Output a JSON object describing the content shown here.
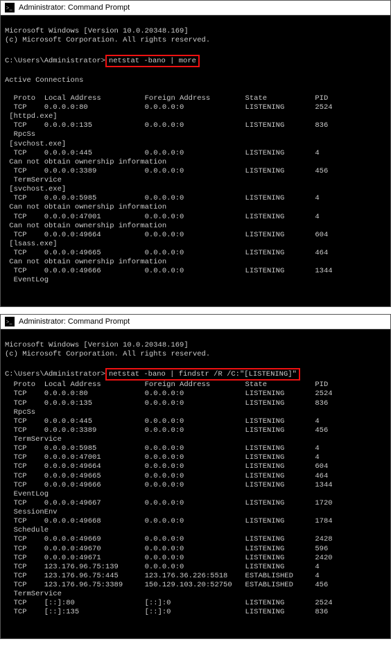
{
  "window1": {
    "title": "Administrator: Command Prompt",
    "header1": "Microsoft Windows [Version 10.0.20348.169]",
    "header2": "(c) Microsoft Corporation. All rights reserved.",
    "prompt": "C:\\Users\\Administrator>",
    "command": "netstat -bano | more",
    "section": "Active Connections",
    "colHeader": "  Proto  Local Address          Foreign Address        State           PID",
    "rows": [
      "  TCP    0.0.0.0:80             0.0.0.0:0              LISTENING       2524",
      " [httpd.exe]",
      "  TCP    0.0.0.0:135            0.0.0.0:0              LISTENING       836",
      "  RpcSs",
      " [svchost.exe]",
      "  TCP    0.0.0.0:445            0.0.0.0:0              LISTENING       4",
      " Can not obtain ownership information",
      "  TCP    0.0.0.0:3389           0.0.0.0:0              LISTENING       456",
      "  TermService",
      " [svchost.exe]",
      "  TCP    0.0.0.0:5985           0.0.0.0:0              LISTENING       4",
      " Can not obtain ownership information",
      "  TCP    0.0.0.0:47001          0.0.0.0:0              LISTENING       4",
      " Can not obtain ownership information",
      "  TCP    0.0.0.0:49664          0.0.0.0:0              LISTENING       604",
      " [lsass.exe]",
      "  TCP    0.0.0.0:49665          0.0.0.0:0              LISTENING       464",
      " Can not obtain ownership information",
      "  TCP    0.0.0.0:49666          0.0.0.0:0              LISTENING       1344",
      "  EventLog"
    ]
  },
  "window2": {
    "title": "Administrator: Command Prompt",
    "header1": "Microsoft Windows [Version 10.0.20348.169]",
    "header2": "(c) Microsoft Corporation. All rights reserved.",
    "prompt": "C:\\Users\\Administrator>",
    "command": "netstat -bano | findstr /R /C:\"[LISTENING]\"",
    "colHeader": "  Proto  Local Address          Foreign Address        State           PID",
    "rows": [
      "  TCP    0.0.0.0:80             0.0.0.0:0              LISTENING       2524",
      "  TCP    0.0.0.0:135            0.0.0.0:0              LISTENING       836",
      "  RpcSs",
      "  TCP    0.0.0.0:445            0.0.0.0:0              LISTENING       4",
      "  TCP    0.0.0.0:3389           0.0.0.0:0              LISTENING       456",
      "  TermService",
      "  TCP    0.0.0.0:5985           0.0.0.0:0              LISTENING       4",
      "  TCP    0.0.0.0:47001          0.0.0.0:0              LISTENING       4",
      "  TCP    0.0.0.0:49664          0.0.0.0:0              LISTENING       604",
      "  TCP    0.0.0.0:49665          0.0.0.0:0              LISTENING       464",
      "  TCP    0.0.0.0:49666          0.0.0.0:0              LISTENING       1344",
      "  EventLog",
      "  TCP    0.0.0.0:49667          0.0.0.0:0              LISTENING       1720",
      "  SessionEnv",
      "  TCP    0.0.0.0:49668          0.0.0.0:0              LISTENING       1784",
      "  Schedule",
      "  TCP    0.0.0.0:49669          0.0.0.0:0              LISTENING       2428",
      "  TCP    0.0.0.0:49670          0.0.0.0:0              LISTENING       596",
      "  TCP    0.0.0.0:49671          0.0.0.0:0              LISTENING       2420",
      "  TCP    123.176.96.75:139      0.0.0.0:0              LISTENING       4",
      "  TCP    123.176.96.75:445      123.176.36.226:5518    ESTABLISHED     4",
      "  TCP    123.176.96.75:3389     150.129.103.20:52750   ESTABLISHED     456",
      "  TermService",
      "  TCP    [::]:80                [::]:0                 LISTENING       2524",
      "  TCP    [::]:135               [::]:0                 LISTENING       836"
    ]
  }
}
